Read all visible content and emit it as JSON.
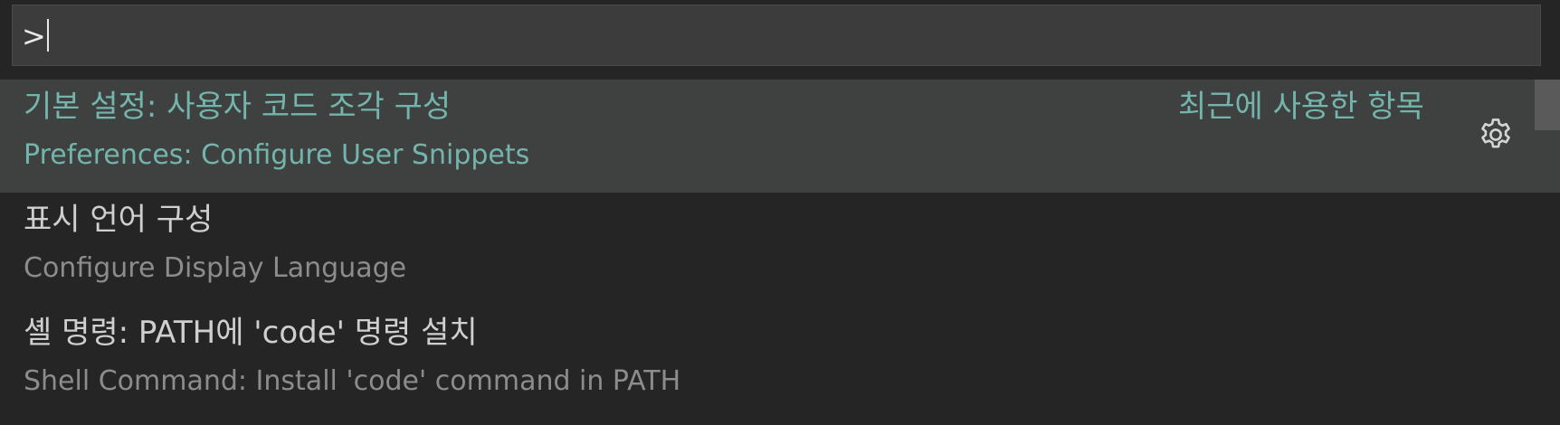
{
  "command_palette": {
    "input_value": ">",
    "items": [
      {
        "label": "기본 설정: 사용자 코드 조각 구성",
        "detail": "Preferences: Configure User Snippets",
        "meta": "최근에 사용한 항목",
        "selected": true
      },
      {
        "label": "표시 언어 구성",
        "detail": "Configure Display Language",
        "selected": false
      },
      {
        "label": "셸 명령: PATH에 'code' 명령 설치",
        "detail": "Shell Command: Install 'code' command in PATH",
        "selected": false
      }
    ],
    "gear_icon": "gear-icon",
    "scrollbar": {
      "position": 0
    }
  },
  "colors": {
    "background": "#252526",
    "input_background": "#3c3c3c",
    "selected_background": "#3f4140",
    "highlight_text": "#73b5ac",
    "label_text": "#cfcfcf",
    "detail_text": "#8c8c8c"
  }
}
